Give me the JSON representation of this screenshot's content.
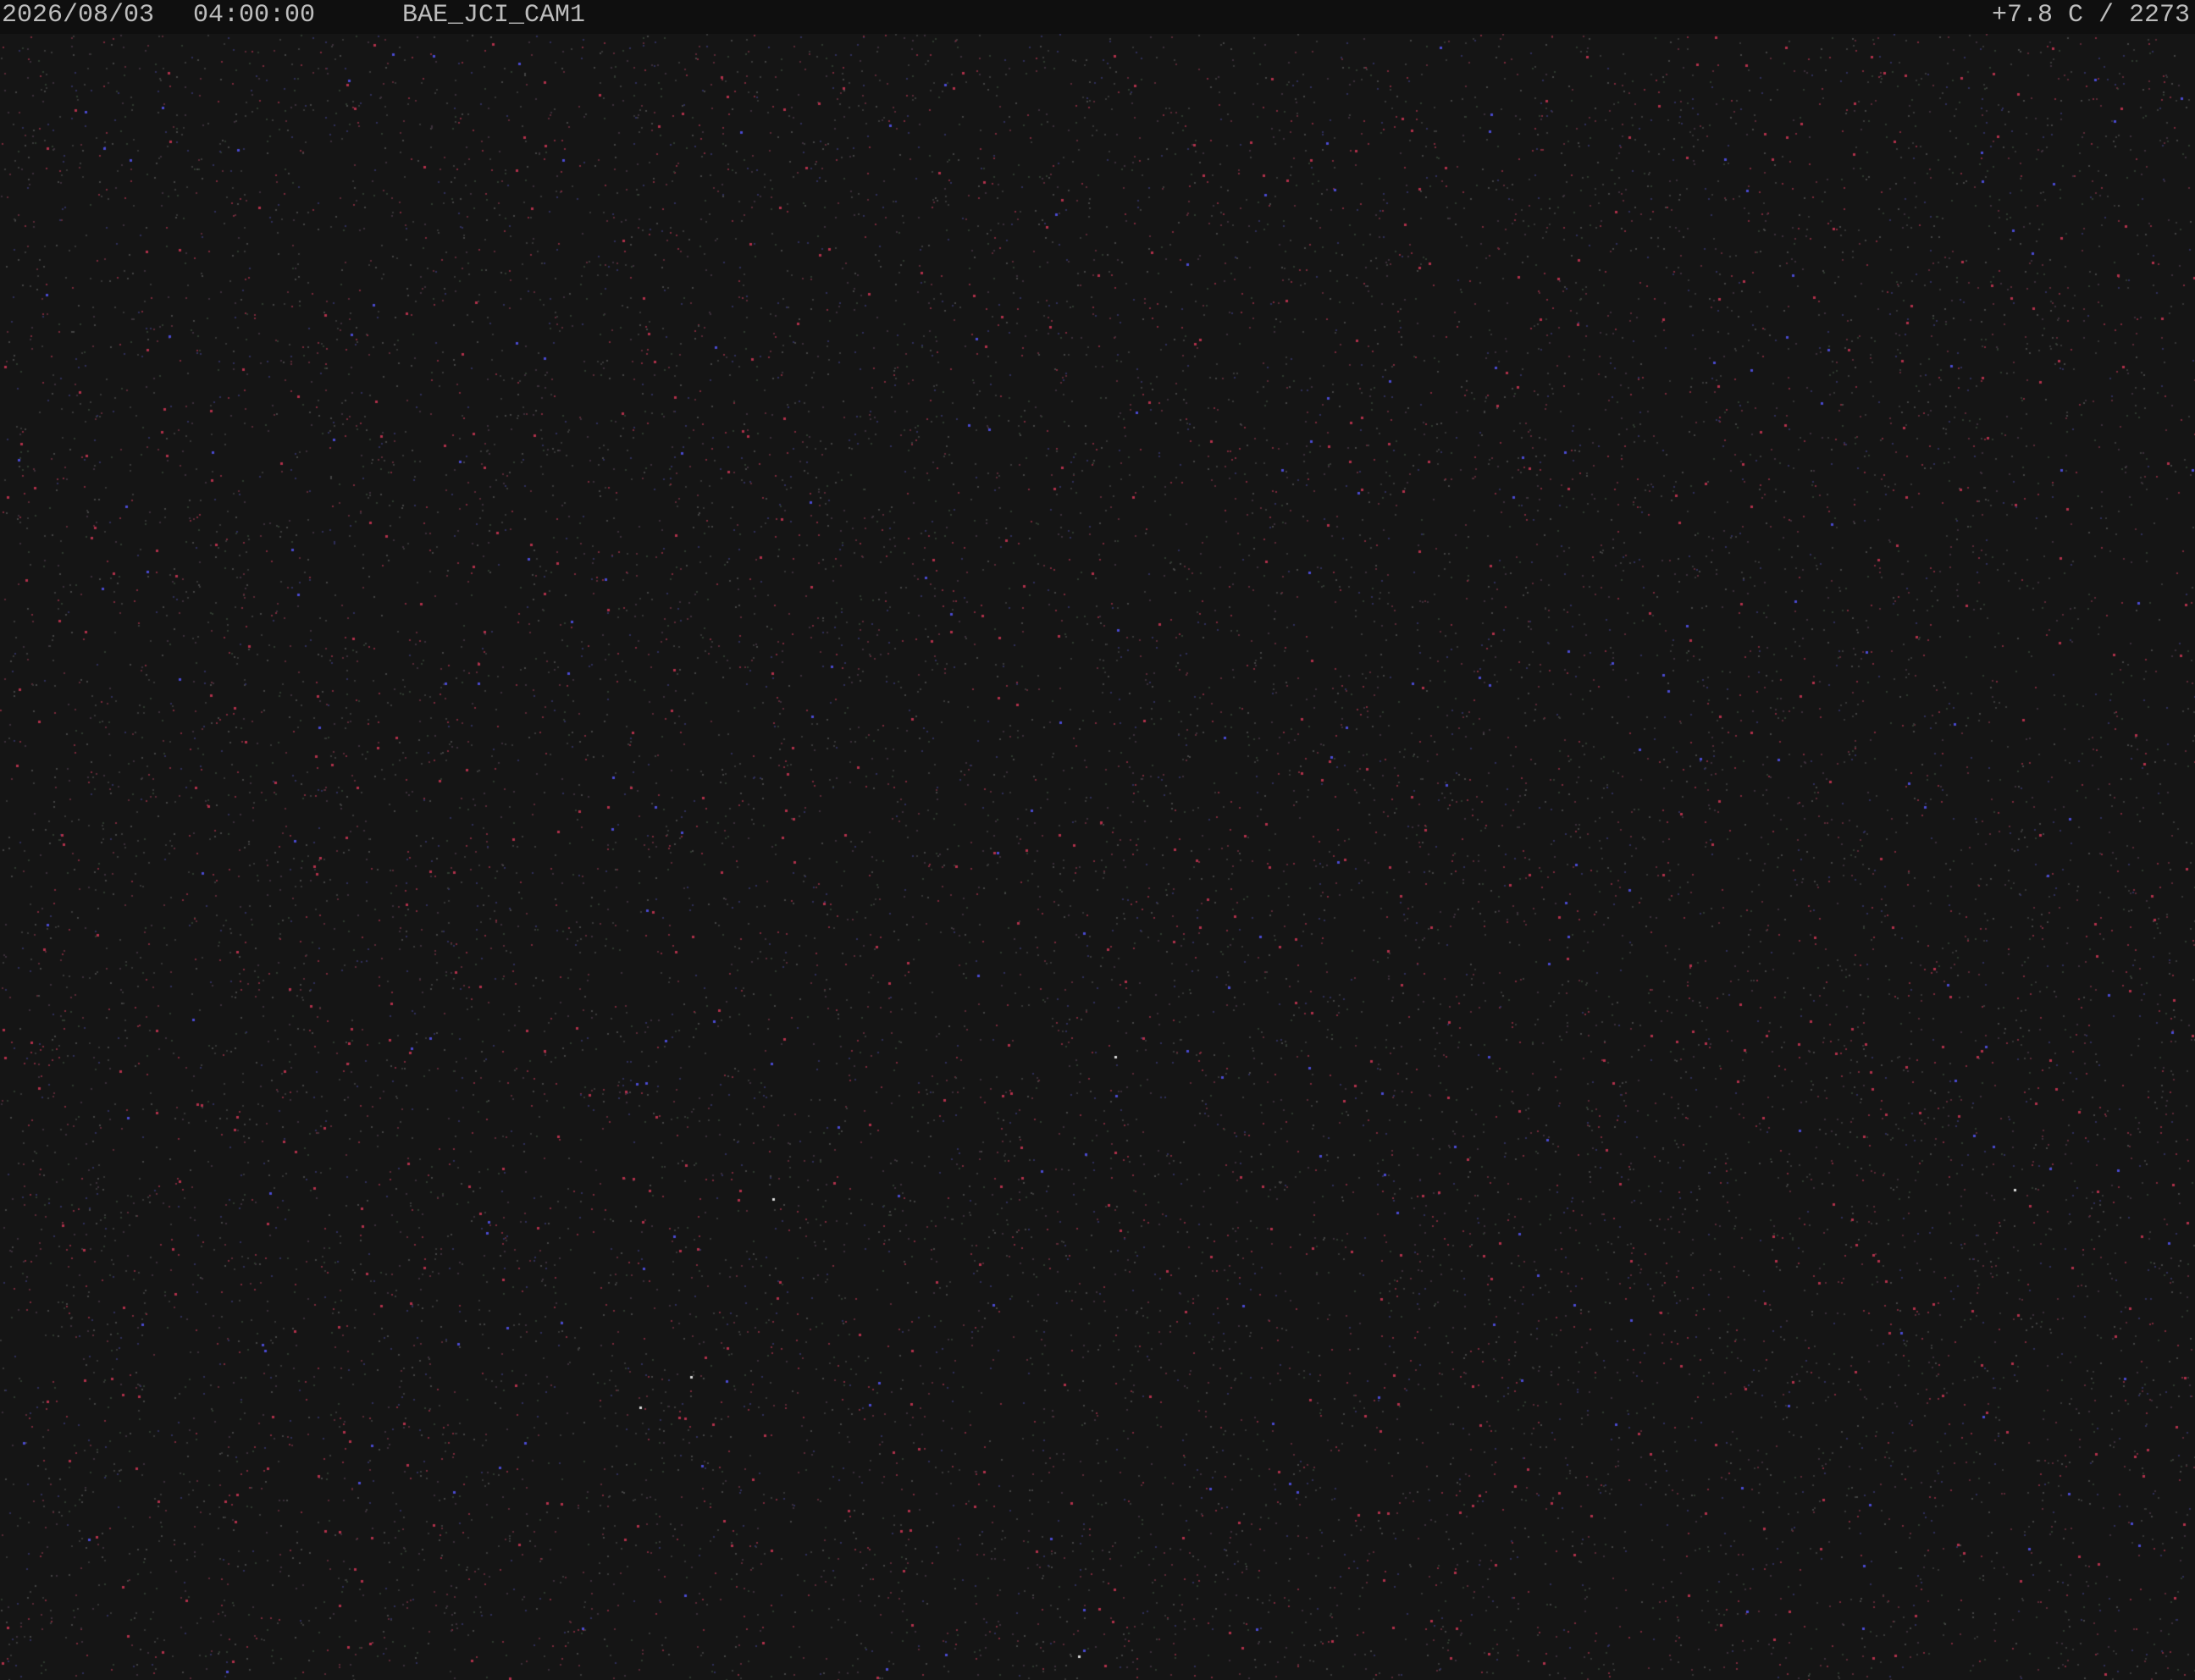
{
  "osd": {
    "date": "2026/08/03",
    "time": "04:00:00",
    "camera_name": "BAE_JCI_CAM1",
    "status": "+7.8 C / 2273"
  },
  "colors": {
    "background": "#151515",
    "osd_bar": "#0f0f0f",
    "osd_text": "#bdbdbd"
  }
}
